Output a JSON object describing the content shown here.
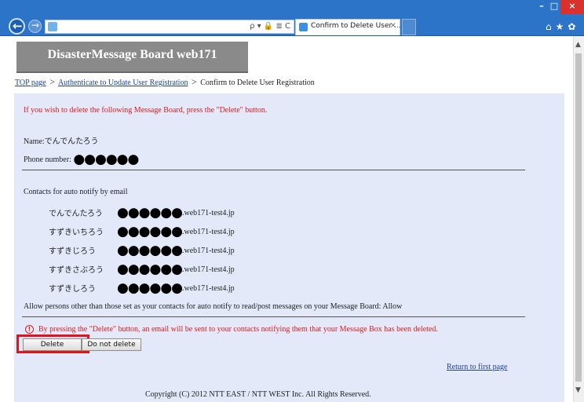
{
  "browser": {
    "tab_title": "Confirm to Delete User ...",
    "tab_close": "×",
    "address_controls": "ρ ▾ 🔒 ≣ C",
    "window_min": "–",
    "window_max": "□",
    "window_close": "×",
    "toolbar_icons": "⌂★✿",
    "back_glyph": "←",
    "forward_glyph": "→",
    "scroll_up": "▲",
    "scroll_down": "▼"
  },
  "page": {
    "banner_title": "DisasterMessage Board web171",
    "breadcrumb": {
      "top": "TOP page",
      "auth": "Authenticate to Update User Registration",
      "current": "Confirm to Delete User Registration",
      "separator": ">"
    },
    "intro_text": "If you wish to delete the following Message Board, press the \"Delete\" button.",
    "name_label": "Name:",
    "name_value": "でんでんたろう",
    "phone_label": "Phone number:",
    "masked": "●●●●●●",
    "contacts_heading": "Contacts for auto notify by email",
    "contacts": [
      {
        "name": "でんでんたろう",
        "domain": ".web171-test4.jp"
      },
      {
        "name": "すずきいちろう",
        "domain": ".web171-test4.jp"
      },
      {
        "name": "すずきじろう",
        "domain": ".web171-test4.jp"
      },
      {
        "name": "すずきさぶろう",
        "domain": ".web171-test4.jp"
      },
      {
        "name": "すずきしろう",
        "domain": ".web171-test4.jp"
      }
    ],
    "allow_text": "Allow persons other than those set as your contacts for auto notify to read/post messages on your Message Board: Allow",
    "warning_icon": "!",
    "warning_text": "By pressing the \"Delete\" button, an email will be sent to your contacts notifying them that your Message Box has been deleted.",
    "delete_button": "Delete",
    "no_delete_button": "Do not delete",
    "return_link": "Return to first page",
    "copyright": "Copyright (C) 2012 NTT EAST / NTT WEST Inc. All Rights Reserved."
  },
  "colors": {
    "chrome": "#2b74c7",
    "panel": "#e3e9f9",
    "alert_red": "#e01a1a",
    "link": "#1f3ea8",
    "highlight": "#e0141b"
  }
}
